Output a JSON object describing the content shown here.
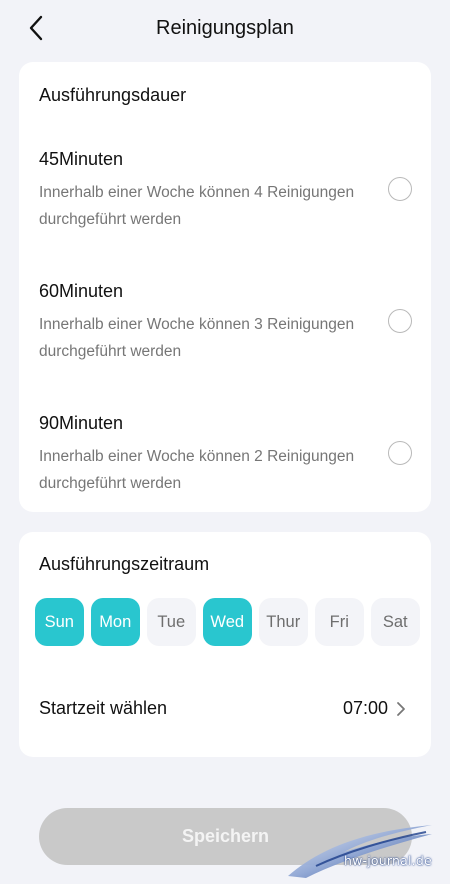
{
  "header": {
    "title": "Reinigungsplan"
  },
  "duration": {
    "title": "Ausführungsdauer",
    "options": [
      {
        "label": "45Minuten",
        "desc": "Innerhalb einer Woche können 4 Reinigungen durchgeführt werden",
        "selected": false
      },
      {
        "label": "60Minuten",
        "desc": "Innerhalb einer Woche können 3 Reinigungen durchgeführt werden",
        "selected": false
      },
      {
        "label": "90Minuten",
        "desc": "Innerhalb einer Woche können 2 Reinigungen durchgeführt werden",
        "selected": false
      }
    ]
  },
  "period": {
    "title": "Ausführungszeitraum",
    "days": [
      {
        "label": "Sun",
        "active": true
      },
      {
        "label": "Mon",
        "active": true
      },
      {
        "label": "Tue",
        "active": false
      },
      {
        "label": "Wed",
        "active": true
      },
      {
        "label": "Thur",
        "active": false
      },
      {
        "label": "Fri",
        "active": false
      },
      {
        "label": "Sat",
        "active": false
      }
    ],
    "start_label": "Startzeit wählen",
    "start_value": "07:00"
  },
  "save_label": "Speichern",
  "watermark": "hw-journal.de",
  "colors": {
    "accent": "#29c6cf",
    "background": "#f2f3f8",
    "disabled_button": "#c9c9c9"
  }
}
